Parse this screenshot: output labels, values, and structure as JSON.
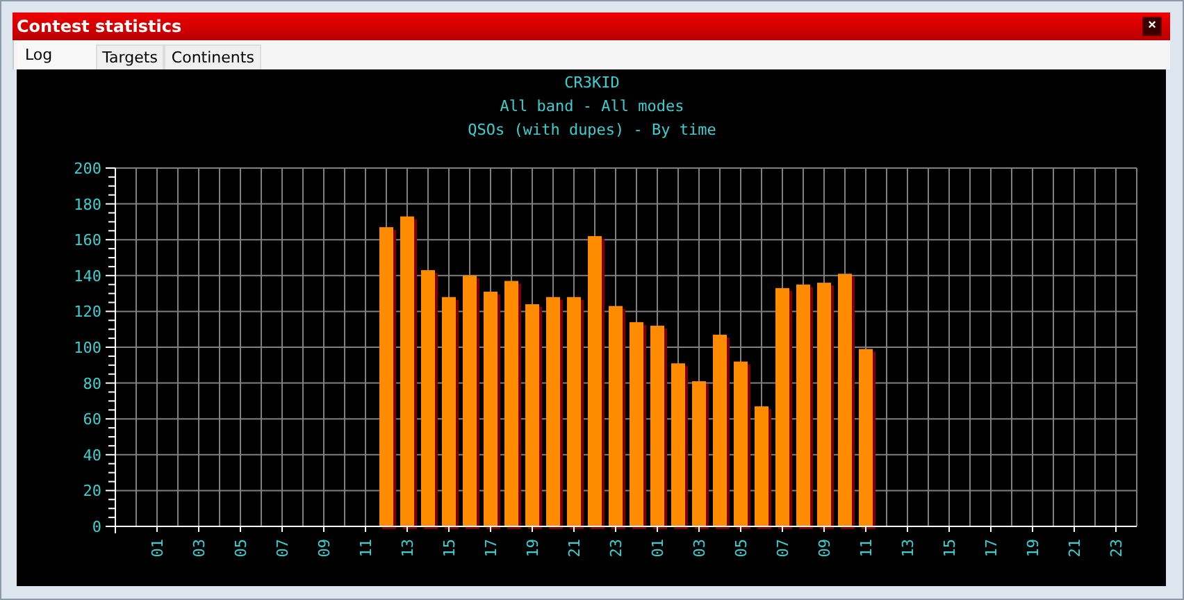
{
  "window": {
    "title": "Contest statistics",
    "close": "×"
  },
  "tabs": [
    {
      "label": "Log",
      "selected": true
    },
    {
      "label": "Targets",
      "selected": false
    },
    {
      "label": "Continents",
      "selected": false
    }
  ],
  "chart": {
    "titles": [
      "CR3KID",
      "All band - All modes",
      "QSOs (with dupes) - By time"
    ],
    "chart_data": {
      "type": "bar",
      "categories": [
        null,
        null,
        "01",
        null,
        "03",
        null,
        "05",
        null,
        "07",
        null,
        "09",
        null,
        "11",
        null,
        "13",
        null,
        "15",
        null,
        "17",
        null,
        "19",
        null,
        "21",
        null,
        "23",
        null,
        "01",
        null,
        "03",
        null,
        "05",
        null,
        "07",
        null,
        "09",
        null,
        "11",
        null,
        "13",
        null,
        "15",
        null,
        "17",
        null,
        "19",
        null,
        "21",
        null,
        "23"
      ],
      "values": [
        null,
        null,
        null,
        null,
        null,
        null,
        null,
        null,
        null,
        null,
        null,
        null,
        null,
        167,
        173,
        143,
        128,
        140,
        131,
        137,
        124,
        128,
        128,
        162,
        123,
        114,
        112,
        91,
        81,
        107,
        92,
        67,
        133,
        135,
        136,
        141,
        99,
        null,
        null,
        null,
        null,
        null,
        null,
        null,
        null,
        null,
        null,
        null,
        null
      ],
      "ylim": [
        0,
        200
      ],
      "grid": true,
      "yticks": [
        0,
        20,
        40,
        60,
        80,
        100,
        120,
        140,
        160,
        180,
        200
      ]
    }
  }
}
